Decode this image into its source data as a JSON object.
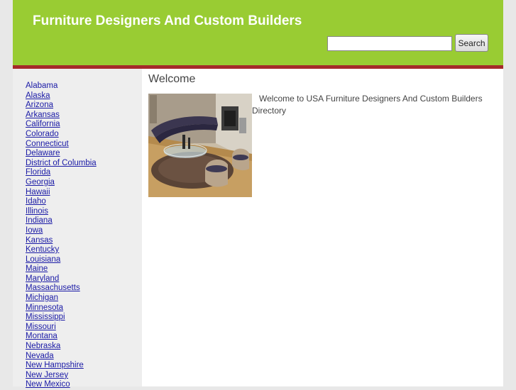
{
  "header": {
    "title": "Furniture Designers And Custom Builders",
    "search": {
      "value": "",
      "placeholder": "",
      "button_label": "Search"
    }
  },
  "sidebar": {
    "states": [
      "Alabama",
      "Alaska",
      "Arizona",
      "Arkansas",
      "California",
      "Colorado",
      "Connecticut",
      "Delaware",
      "District of Columbia",
      "Florida",
      "Georgia",
      "Hawaii",
      "Idaho",
      "Illinois",
      "Indiana",
      "Iowa",
      "Kansas",
      "Kentucky",
      "Louisiana",
      "Maine",
      "Maryland",
      "Massachusetts",
      "Michigan",
      "Minnesota",
      "Mississippi",
      "Missouri",
      "Montana",
      "Nebraska",
      "Nevada",
      "New Hampshire",
      "New Jersey",
      "New Mexico"
    ]
  },
  "main": {
    "heading": "Welcome",
    "text": "Welcome to USA Furniture Designers And Custom Builders Directory"
  },
  "colors": {
    "header_green": "#99cc33",
    "header_bar": "#a52a2a",
    "link": "#1a1aa6",
    "sidebar_bg": "#eeeeee",
    "page_bg": "#e8e8e8"
  }
}
